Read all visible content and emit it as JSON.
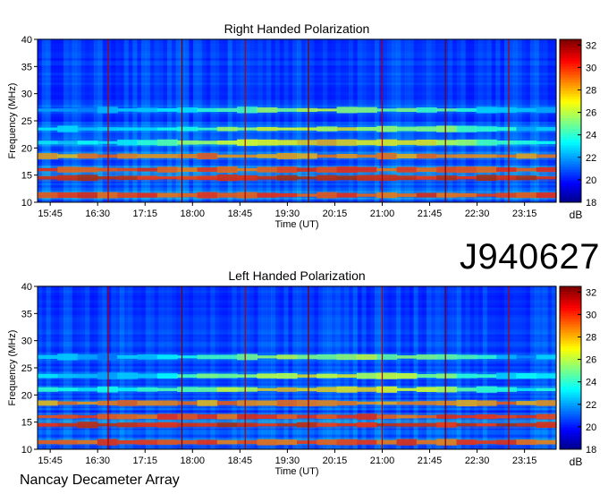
{
  "page": {
    "event_id": "J940627",
    "instrument": "Nancay Decameter Array"
  },
  "chart_data": [
    {
      "type": "heatmap",
      "title": "Right Handed Polarization",
      "xlabel": "Time (UT)",
      "ylabel": "Frequency (MHz)",
      "x_ticks": [
        "15:45",
        "16:30",
        "17:15",
        "18:00",
        "18:45",
        "19:30",
        "20:15",
        "21:00",
        "21:45",
        "22:30",
        "23:15"
      ],
      "y_ticks": [
        10,
        15,
        20,
        25,
        30,
        35,
        40
      ],
      "ylim": [
        10,
        40
      ],
      "colorbar": {
        "label": "dB",
        "ticks": [
          18,
          20,
          22,
          24,
          26,
          28,
          30,
          32
        ],
        "range": [
          18,
          32.5
        ],
        "colormap": "jet"
      },
      "strong_bands": [
        {
          "freq": 11.3,
          "intensity": 31
        },
        {
          "freq": 14.5,
          "intensity": 32
        },
        {
          "freq": 16.0,
          "intensity": 31
        },
        {
          "freq": 18.5,
          "intensity": 30
        },
        {
          "freq": 21.0,
          "intensity": 29
        },
        {
          "freq": 23.5,
          "intensity": 28
        },
        {
          "freq": 27.0,
          "intensity": 27
        }
      ],
      "vertical_markers_time": [
        "16:40",
        "17:50",
        "18:50",
        "19:50",
        "21:00",
        "22:00",
        "23:00"
      ]
    },
    {
      "type": "heatmap",
      "title": "Left Handed Polarization",
      "xlabel": "Time (UT)",
      "ylabel": "Frequency (MHz)",
      "x_ticks": [
        "15:45",
        "16:30",
        "17:15",
        "18:00",
        "18:45",
        "19:30",
        "20:15",
        "21:00",
        "21:45",
        "22:30",
        "23:15"
      ],
      "y_ticks": [
        10,
        15,
        20,
        25,
        30,
        35,
        40
      ],
      "ylim": [
        10,
        40
      ],
      "colorbar": {
        "label": "dB",
        "ticks": [
          18,
          20,
          22,
          24,
          26,
          28,
          30,
          32
        ],
        "range": [
          18,
          32.5
        ],
        "colormap": "jet"
      },
      "strong_bands": [
        {
          "freq": 11.3,
          "intensity": 31
        },
        {
          "freq": 14.5,
          "intensity": 32
        },
        {
          "freq": 16.0,
          "intensity": 31
        },
        {
          "freq": 18.5,
          "intensity": 30
        },
        {
          "freq": 21.0,
          "intensity": 29
        },
        {
          "freq": 23.5,
          "intensity": 28
        },
        {
          "freq": 27.0,
          "intensity": 27
        }
      ],
      "vertical_markers_time": [
        "16:40",
        "17:50",
        "18:50",
        "19:50",
        "21:00",
        "22:00",
        "23:00"
      ]
    }
  ]
}
